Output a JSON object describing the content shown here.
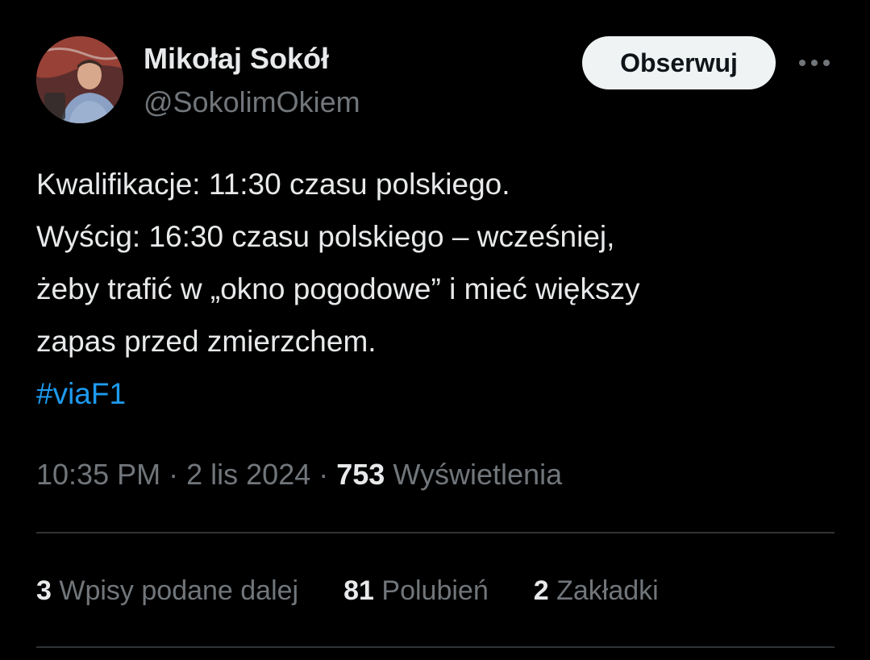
{
  "author": {
    "display_name": "Mikołaj Sokół",
    "handle": "@SokolimOkiem",
    "avatar_icon": "profile-photo"
  },
  "follow_label": "Obserwuj",
  "more_icon": "more-horizontal-icon",
  "text_lines": [
    "Kwalifikacje: 11:30 czasu polskiego.",
    "Wyścig: 16:30 czasu polskiego – wcześniej,",
    "żeby trafić w „okno pogodowe” i mieć większy",
    "zapas przed zmierzchem."
  ],
  "hashtag": "#viaF1",
  "meta": {
    "time": "10:35 PM",
    "separator": "·",
    "date": "2 lis 2024",
    "views_count": "753",
    "views_label": "Wyświetlenia"
  },
  "stats": {
    "retweets_count": "3",
    "retweets_label": "Wpisy podane dalej",
    "likes_count": "81",
    "likes_label": "Polubień",
    "bookmarks_count": "2",
    "bookmarks_label": "Zakładki"
  },
  "colors": {
    "background": "#000000",
    "text": "#e7e9ea",
    "muted": "#71767b",
    "link": "#1d9bf0",
    "divider": "#2f3336",
    "button_bg": "#eff3f4"
  }
}
